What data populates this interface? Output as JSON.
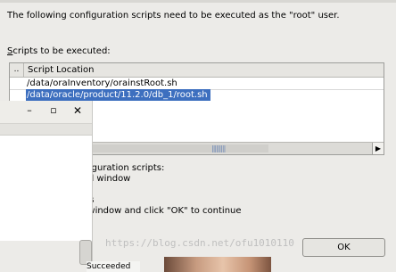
{
  "dialog": {
    "message": "The following configuration scripts need to be executed as the \"root\" user.",
    "scripts_label_mnemonic": "S",
    "scripts_label_rest": "cripts to be executed:"
  },
  "table": {
    "col_num_header": "..",
    "col_location_header": "Script Location",
    "rows": [
      "/data/oraInventory/orainstRoot.sh",
      "/data/oracle/product/11.2.0/db_1/root.sh"
    ],
    "selected_row": 1,
    "scroll_right_glyph": "▶",
    "scroll_grip": "|||||||||"
  },
  "instructions": [
    "nfiguration scripts:",
    "nal window",
    "ot\"",
    "pts",
    "s window and click \"OK\" to continue"
  ],
  "buttons": {
    "ok": "OK"
  },
  "overlay_window": {
    "minimize_glyph": "–",
    "maximize_glyph": "▫",
    "close_glyph": "✕",
    "status_text": "Succeeded"
  },
  "watermark": "https://blog.csdn.net/ofu1010110"
}
